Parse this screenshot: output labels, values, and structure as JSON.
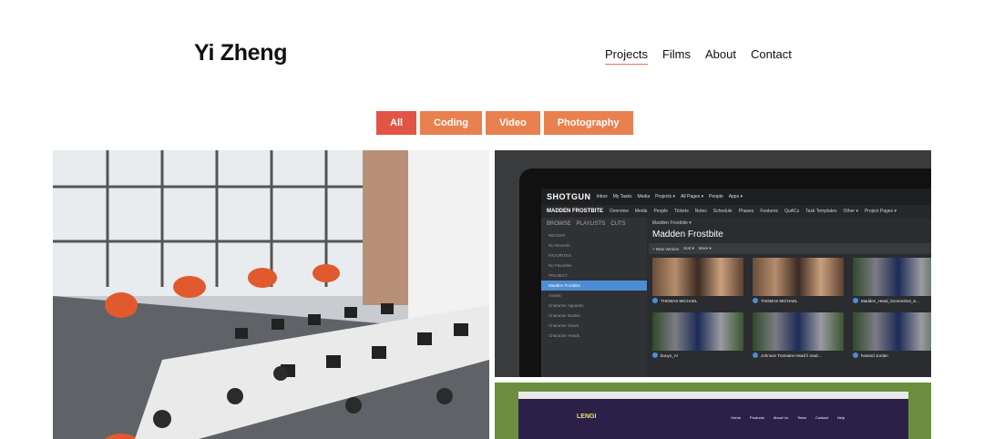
{
  "site": {
    "title": "Yi Zheng"
  },
  "nav": [
    {
      "label": "Projects",
      "active": true
    },
    {
      "label": "Films",
      "active": false
    },
    {
      "label": "About",
      "active": false
    },
    {
      "label": "Contact",
      "active": false
    }
  ],
  "filters": [
    {
      "label": "All",
      "active": true
    },
    {
      "label": "Coding",
      "active": false
    },
    {
      "label": "Video",
      "active": false
    },
    {
      "label": "Photography",
      "active": false
    }
  ],
  "colors": {
    "accent": "#e8814f",
    "accent_active": "#e25545",
    "underline": "#e8734a"
  },
  "shotgun": {
    "logo": "SHOTGUN",
    "top_menu": [
      "Inbox",
      "My Tasks",
      "Media",
      "Projects ▾",
      "All Pages ▾",
      "People",
      "Apps ▾"
    ],
    "project": "MADDEN FROSTBITE",
    "project_tabs": [
      "Overview",
      "Media",
      "People",
      "Tickets",
      "Notes",
      "Schedule",
      "Phases",
      "Features",
      "QuACs",
      "Task Templates",
      "Other ▾",
      "Project Pages ▾"
    ],
    "side_tabs": [
      "BROWSE",
      "PLAYLISTS",
      "CUTS"
    ],
    "side_rows": [
      "RECENT",
      "No Recents",
      "FAVORITES",
      "No Favorites",
      "PROJECT",
      "Madden Frostbite",
      "Assets",
      "Character Apparels",
      "Character Bodies",
      "Character Gears",
      "Character Heads"
    ],
    "breadcrumb": "Madden Frostbite ▾",
    "heading": "Madden Frostbite",
    "toolbar": [
      "+ New Version",
      "Sort ▾",
      "More ▾"
    ],
    "thumbs": [
      "THOMAS MICHAEL",
      "THOMAS MICHAEL",
      "Madden_Head_Screenshot_S...",
      "bouyo_Al",
      "Johnson Tramaine Head li read...",
      "howard Jordan"
    ]
  },
  "web": {
    "logo": "LENGI",
    "nav": [
      "Home",
      "Products",
      "About Us",
      "Team",
      "Contact",
      "Help"
    ]
  }
}
